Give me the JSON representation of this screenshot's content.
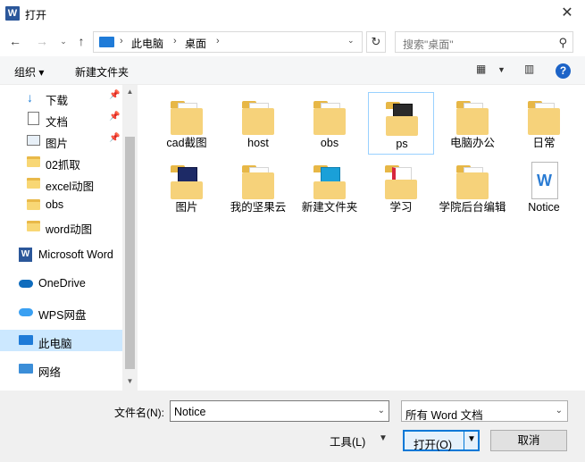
{
  "window": {
    "title": "打开",
    "logo": "W",
    "logo_icon": "word-logo-icon",
    "close_icon": "close-icon"
  },
  "nav": {
    "back_icon": "arrow-left-icon",
    "forward_icon": "arrow-right-icon",
    "recent_icon": "chevron-down-icon",
    "up_icon": "arrow-up-icon",
    "breadcrumb": [
      "此电脑",
      "桌面"
    ],
    "refresh_icon": "refresh-icon",
    "search_placeholder": "搜索\"桌面\""
  },
  "toolbar": {
    "organize": "组织 ▾",
    "new_folder": "新建文件夹"
  },
  "sidebar": {
    "items": [
      {
        "label": "下载",
        "icon": "download-icon",
        "pinned": true
      },
      {
        "label": "文档",
        "icon": "document-icon",
        "pinned": true
      },
      {
        "label": "图片",
        "icon": "picture-icon",
        "pinned": true
      },
      {
        "label": "02抓取",
        "icon": "folder-icon",
        "pinned": false
      },
      {
        "label": "excel动图",
        "icon": "folder-icon",
        "pinned": false
      },
      {
        "label": "obs",
        "icon": "folder-icon",
        "pinned": false
      },
      {
        "label": "word动图",
        "icon": "folder-icon",
        "pinned": false
      },
      {
        "label": "Microsoft Word",
        "icon": "word-icon",
        "pinned": false
      },
      {
        "label": "OneDrive",
        "icon": "cloud-icon",
        "pinned": false
      },
      {
        "label": "WPS网盘",
        "icon": "wps-cloud-icon",
        "pinned": false
      },
      {
        "label": "此电脑",
        "icon": "computer-icon",
        "pinned": false,
        "selected": true
      },
      {
        "label": "网络",
        "icon": "network-icon",
        "pinned": false
      }
    ]
  },
  "files": [
    {
      "name": "cad截图",
      "type": "folder"
    },
    {
      "name": "host",
      "type": "folder"
    },
    {
      "name": "obs",
      "type": "folder"
    },
    {
      "name": "ps",
      "type": "folder",
      "selected": true
    },
    {
      "name": "电脑办公",
      "type": "folder"
    },
    {
      "name": "日常",
      "type": "folder"
    },
    {
      "name": "图片",
      "type": "folder"
    },
    {
      "name": "我的坚果云",
      "type": "folder"
    },
    {
      "name": "新建文件夹",
      "type": "folder"
    },
    {
      "name": "学习",
      "type": "folder"
    },
    {
      "name": "学院后台编辑",
      "type": "folder"
    },
    {
      "name": "Notice",
      "type": "word"
    }
  ],
  "footer": {
    "filename_label": "文件名(N):",
    "filename_value": "Notice",
    "filetype_value": "所有 Word 文档",
    "tools_label": "工具(L)",
    "open_label": "打开(O)",
    "cancel_label": "取消"
  },
  "colors": {
    "accent": "#0078d7",
    "selected_bg": "#cce8ff",
    "folder": "#f6d27a",
    "word_blue": "#2b579a"
  }
}
